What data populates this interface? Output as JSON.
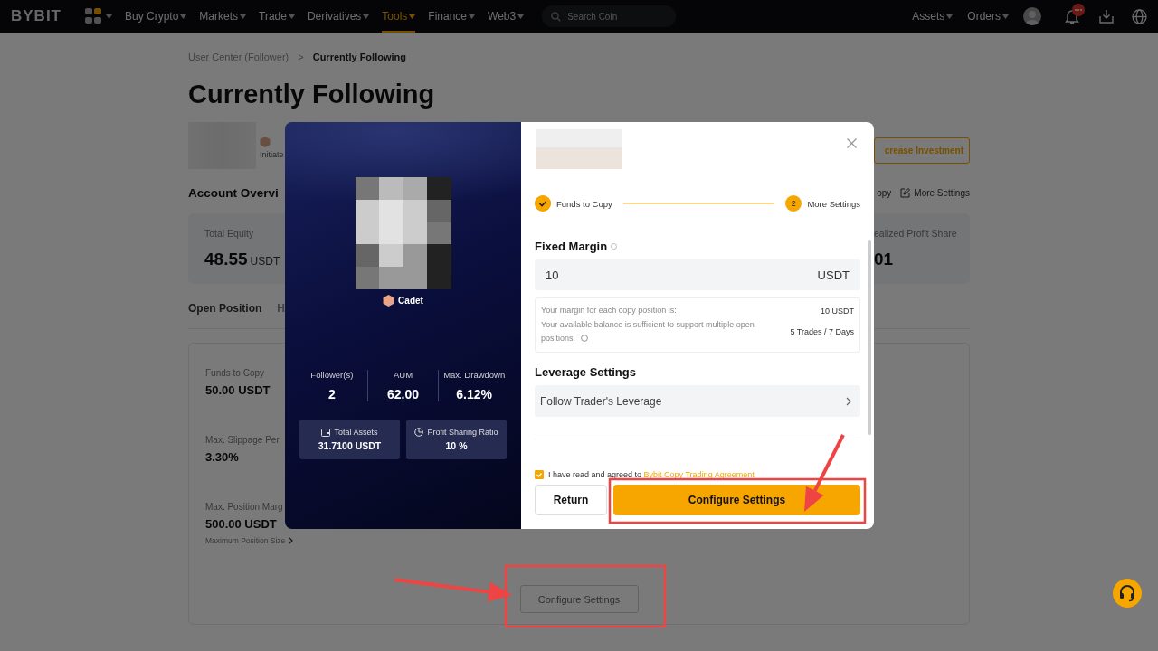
{
  "nav": {
    "logo": "BYBIT",
    "menu": [
      {
        "label": "Buy Crypto",
        "selected": false
      },
      {
        "label": "Markets",
        "selected": false
      },
      {
        "label": "Trade",
        "selected": false
      },
      {
        "label": "Derivatives",
        "selected": false
      },
      {
        "label": "Tools",
        "selected": true
      },
      {
        "label": "Finance",
        "selected": false
      },
      {
        "label": "Web3",
        "selected": false
      }
    ],
    "search": {
      "placeholder": "Search Coin"
    },
    "account_menu": [
      {
        "label": "Assets"
      },
      {
        "label": "Orders"
      }
    ]
  },
  "breadcrumb": {
    "separator": ">",
    "items": [
      {
        "label": "User Center (Follower)",
        "selected": false
      },
      {
        "label": "Currently Following",
        "selected": true
      }
    ]
  },
  "title": "Currently Following",
  "trader": {
    "badge": "Initiate",
    "button": "crease Investment"
  },
  "overview": {
    "title": "Account Overvi",
    "actions": [
      {
        "kind": "text",
        "label": "opy"
      },
      {
        "kind": "edit",
        "label": "More Settings"
      }
    ],
    "cards": [
      {
        "label": "Total Equity",
        "value": "48.55",
        "unit": "USDT"
      },
      {
        "label": "ealized Profit Share",
        "value": "01"
      }
    ]
  },
  "tabs": [
    {
      "label": "Open Position",
      "selected": true
    },
    {
      "label": "H",
      "selected": false
    }
  ],
  "settings": {
    "fields": [
      {
        "label": "Funds to Copy",
        "value": "50.00 USDT"
      },
      {
        "label": "Max. Slippage Per",
        "value": "3.30%"
      },
      {
        "label": "Max. Position Marg",
        "value": "500.00 USDT",
        "link": "Maximum Position Size"
      }
    ],
    "button": "Configure Settings"
  },
  "modal": {
    "trader": {
      "rank": "Cadet"
    },
    "stats": [
      {
        "label": "Follower(s)",
        "value": "2"
      },
      {
        "label": "AUM",
        "value": "62.00"
      },
      {
        "label": "Max. Drawdown",
        "value": "6.12%"
      }
    ],
    "tiles": [
      {
        "kind": "wallet",
        "label": "Total Assets",
        "value": "31.7100 USDT"
      },
      {
        "kind": "pie",
        "label": "Profit Sharing Ratio",
        "value": "10 %"
      }
    ],
    "steps": [
      {
        "label": "Funds to Copy",
        "completed": true
      },
      {
        "number": "2",
        "label": "More Settings",
        "completed": false
      }
    ],
    "fixed_margin": {
      "label": "Fixed Margin",
      "value": "10",
      "unit": "USDT"
    },
    "info": [
      {
        "text": "Your margin for each copy position is:",
        "value": "10 USDT"
      },
      {
        "text": "Your available balance is sufficient to support multiple open positions.",
        "value": "5 Trades / 7 Days"
      }
    ],
    "leverage": {
      "label": "Leverage Settings",
      "value": "Follow Trader's Leverage"
    },
    "agreement": {
      "checked": true,
      "text": "I have read and agreed to",
      "link": "Bybit Copy Trading Agreement"
    },
    "buttons": {
      "return": "Return",
      "confirm": "Configure Settings"
    }
  }
}
